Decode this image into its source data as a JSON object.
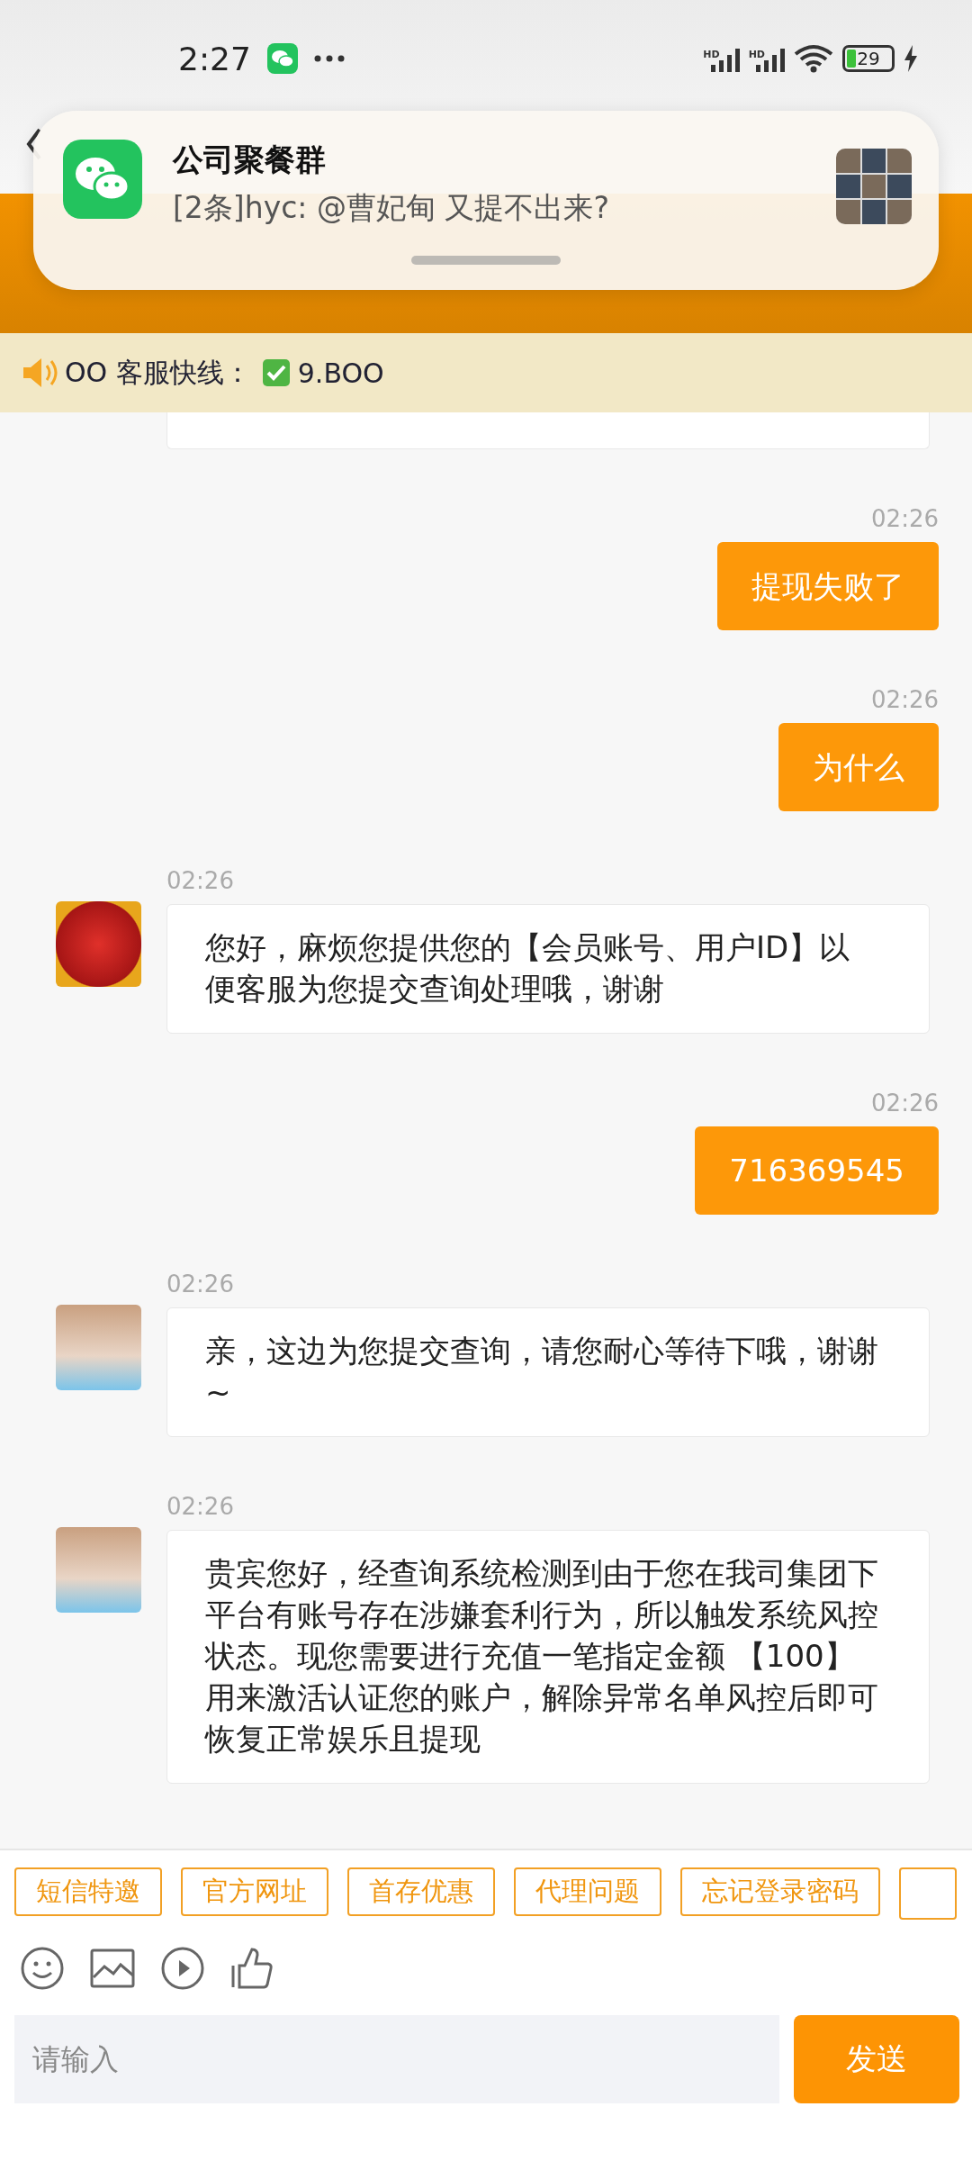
{
  "status_bar": {
    "time": "2:27",
    "signals": [
      "HD",
      "HD"
    ],
    "battery": "29"
  },
  "notification": {
    "title": "公司聚餐群",
    "message": "[2条]hyc: @曹妃甸 又提不出来?"
  },
  "notice": {
    "label": "OO 客服快线：",
    "value": "9.BOO"
  },
  "messages": [
    {
      "kind": "sent",
      "time": "02:26",
      "text": "提现失败了"
    },
    {
      "kind": "sent",
      "time": "02:26",
      "text": "为什么"
    },
    {
      "kind": "received",
      "avatar": {
        "kind": "logo"
      },
      "time": "02:26",
      "text": "您好，麻烦您提供您的【会员账号、用户ID】以便客服为您提交查询处理哦，谢谢"
    },
    {
      "kind": "sent",
      "time": "02:26",
      "text": "716369545"
    },
    {
      "kind": "received",
      "avatar": {
        "kind": "photo"
      },
      "time": "02:26",
      "text": "亲，这边为您提交查询，请您耐心等待下哦，谢谢~"
    },
    {
      "kind": "received",
      "avatar": {
        "kind": "photo"
      },
      "time": "02:26",
      "text": "贵宾您好，经查询系统检测到由于您在我司集团下平台有账号存在涉嫌套利行为，所以触发系统风控状态。现您需要进行充值一笔指定金额 【100】用来激活认证您的账户，解除异常名单风控后即可恢复正常娱乐且提现"
    }
  ],
  "quick_replies": [
    "短信特邀",
    "官方网址",
    "首存优惠",
    "代理问题",
    "忘记登录密码"
  ],
  "input": {
    "placeholder": "请输入"
  },
  "send_button": "发送"
}
